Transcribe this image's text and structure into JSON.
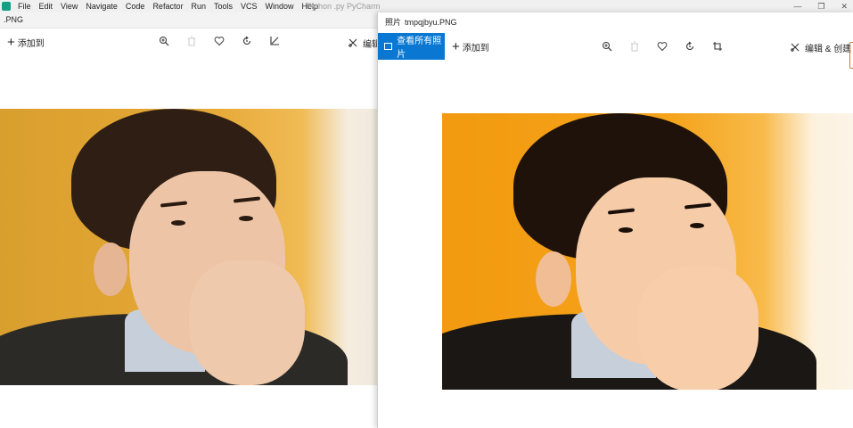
{
  "ide": {
    "menus": [
      "File",
      "Edit",
      "View",
      "Navigate",
      "Code",
      "Refactor",
      "Run",
      "Tools",
      "VCS",
      "Window",
      "Help"
    ],
    "title": "Python   .py   PyCharm",
    "controls": [
      "—",
      "❐",
      "✕"
    ]
  },
  "left_window": {
    "title": ".PNG",
    "add_label": "添加到",
    "edit_label": "编辑",
    "icons": [
      "zoom-in-icon",
      "delete-icon",
      "favorite-icon",
      "rotate-icon",
      "crop-icon",
      "edit-create-icon"
    ]
  },
  "right_window": {
    "app_name": "照片",
    "file_name": "tmpqjbyu.PNG",
    "see_all_label": "查看所有照片",
    "add_label": "添加到",
    "edit_label": "编辑 & 创建",
    "icons": [
      "picture-icon",
      "zoom-in-icon",
      "delete-icon",
      "favorite-icon",
      "rotate-icon",
      "crop-icon",
      "edit-create-icon",
      "chevron-down-icon"
    ]
  },
  "colors": {
    "accent": "#0a78d2",
    "photo_bg_left": "#e0a030",
    "photo_bg_right": "#f2a219"
  }
}
